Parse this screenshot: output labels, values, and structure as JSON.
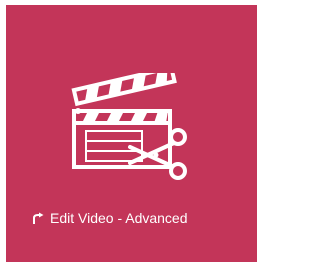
{
  "tile": {
    "label": "Edit Video - Advanced",
    "background_color": "#c33559",
    "icon": "clapperboard-scissors-icon",
    "badge_icon": "shortcut-arrow-icon"
  }
}
